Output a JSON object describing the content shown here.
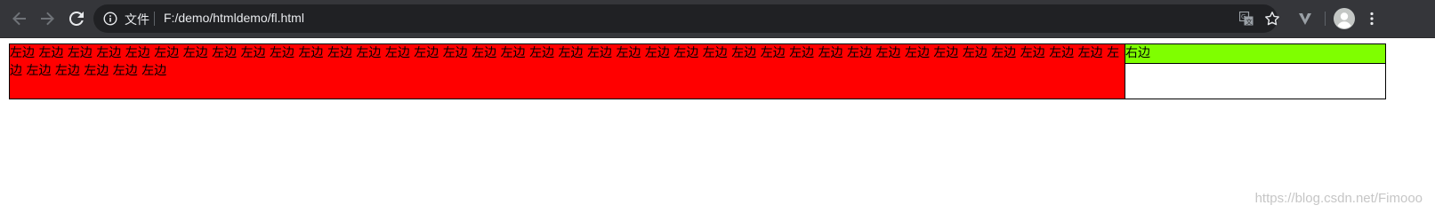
{
  "browser": {
    "site_info_label": "文件",
    "url": "F:/demo/htmldemo/fl.html"
  },
  "page": {
    "left_text": "左边 左边 左边 左边 左边 左边 左边 左边 左边 左边 左边 左边 左边 左边 左边 左边 左边 左边 左边 左边 左边 左边 左边 左边 左边 左边 左边 左边 左边 左边 左边 左边 左边 左边 左边 左边 左边 左边 左边 左边 左边 左边 左边 左边",
    "right_text": "右边",
    "left_background": "#ff0000",
    "right_background": "#7fff00"
  },
  "watermark": "https://blog.csdn.net/Fimooo"
}
